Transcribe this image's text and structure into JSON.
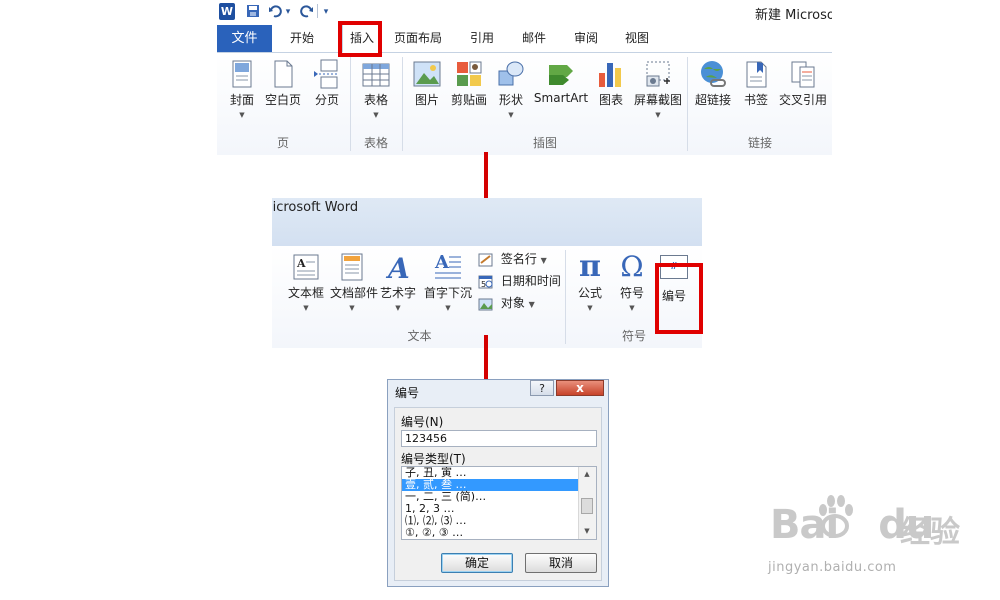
{
  "panel1": {
    "logo": "W",
    "window_title": "新建 Microsoft Word 文档 - Microsoft Word",
    "qat": {
      "undo_dropdown": "▾",
      "customize": "▾"
    },
    "tabs": {
      "file": "文件",
      "home": "开始",
      "insert": "插入",
      "layout": "页面布局",
      "references": "引用",
      "mailings": "邮件",
      "review": "审阅",
      "view": "视图"
    },
    "groups": {
      "pages": {
        "label": "页",
        "buttons": {
          "cover": "封面",
          "blank": "空白页",
          "break": "分页"
        }
      },
      "tables": {
        "label": "表格",
        "buttons": {
          "table": "表格"
        }
      },
      "illustrations": {
        "label": "插图",
        "buttons": {
          "picture": "图片",
          "clipart": "剪贴画",
          "shapes": "形状",
          "smartart": "SmartArt",
          "chart": "图表",
          "screenshot": "屏幕截图"
        }
      },
      "links": {
        "label": "链接",
        "buttons": {
          "hyperlink": "超链接",
          "bookmark": "书签",
          "crossref": "交叉引用"
        }
      }
    }
  },
  "panel2": {
    "title": "licrosoft Word",
    "groups": {
      "text": {
        "label": "文本",
        "buttons": {
          "textbox": "文本框",
          "quickparts": "文档部件",
          "wordart": "艺术字",
          "dropcap": "首字下沉"
        },
        "small": {
          "signature": "签名行",
          "datetime": "日期和时间",
          "object": "对象"
        }
      },
      "symbols": {
        "label": "符号",
        "buttons": {
          "equation": "公式",
          "symbol": "符号",
          "number": "编号"
        },
        "icons": {
          "equation_glyph": "π",
          "symbol_glyph": "Ω",
          "number_glyph": "#"
        }
      }
    }
  },
  "dialog": {
    "title": "编号",
    "help": "?",
    "close": "x",
    "number_label": "编号(N)",
    "number_value": "123456",
    "type_label": "编号类型(T)",
    "list_items": [
      "子, 丑, 寅 …",
      "壹, 贰, 叁 …",
      "一, 二, 三 (简)…",
      "1, 2, 3 …",
      "⑴, ⑵, ⑶ …",
      "①, ②, ③ …"
    ],
    "selected_index": 1,
    "ok": "确定",
    "cancel": "取消"
  },
  "watermark": {
    "brand": "Bai",
    "brand2": "du",
    "cn": "经验",
    "url": "jingyan.baidu.com"
  },
  "colors": {
    "accent_red": "#e00000",
    "file_tab": "#2a62bb",
    "selection": "#3399ff"
  }
}
